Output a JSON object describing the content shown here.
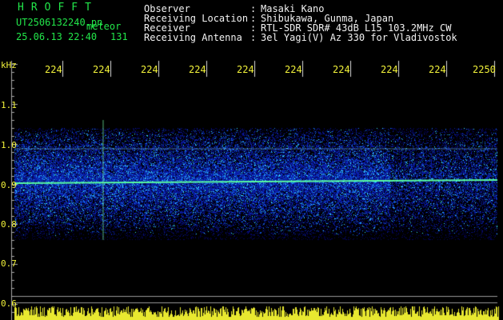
{
  "header": {
    "title": "HROFFT",
    "filename": "UT2506132240.pn",
    "mode": "meteor",
    "datetime": "25.06.13 22:40",
    "count": "131",
    "fields": [
      {
        "label": "Observer",
        "value": "Masaki Kano"
      },
      {
        "label": "Receiving Location",
        "value": "Shibukawa, Gunma, Japan"
      },
      {
        "label": "Receiver",
        "value": "RTL-SDR SDR# 43dB L15 103.2MHz CW"
      },
      {
        "label": "Receiving Antenna",
        "value": "3el Yagi(V) Az 330 for Vladivostok"
      }
    ],
    "sep": ":"
  },
  "axis": {
    "unit": "kHz",
    "x_ticks": [
      "224",
      "224",
      "224",
      "224",
      "224",
      "224",
      "224",
      "224",
      "224",
      "2250"
    ],
    "y_ticks": [
      "1.1",
      "1.0",
      "0.9",
      "0.8",
      "0.7",
      "0.6"
    ]
  },
  "colors": {
    "text_green": "#22e64a",
    "text_white": "#f2f2f2",
    "axis_yellow": "#f2f23a",
    "waterfall_base": "#0a0a8a",
    "signal": "#4aff9a",
    "background": "#000000"
  }
}
